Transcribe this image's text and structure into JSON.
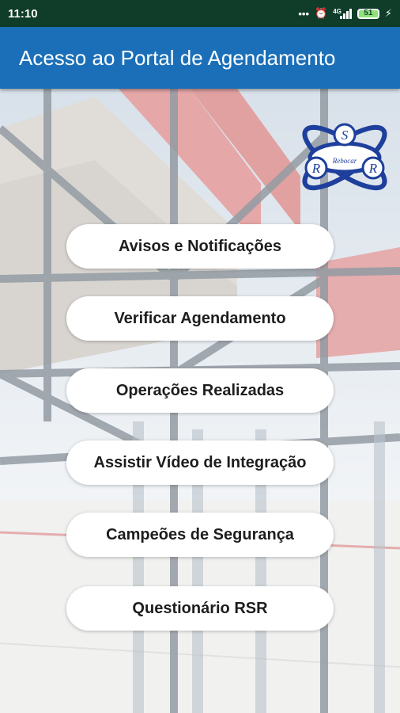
{
  "status_bar": {
    "time": "11:10",
    "network": "4G",
    "battery_level": "51"
  },
  "app_bar": {
    "title": "Acesso ao Portal de Agendamento"
  },
  "logo": {
    "letters": [
      "R",
      "S",
      "R"
    ],
    "subtext": "Rebocar"
  },
  "menu": {
    "items": [
      {
        "label": "Avisos e Notificações"
      },
      {
        "label": "Verificar Agendamento"
      },
      {
        "label": "Operações Realizadas"
      },
      {
        "label": "Assistir Vídeo de Integração"
      },
      {
        "label": "Campeões de Segurança"
      },
      {
        "label": "Questionário RSR"
      }
    ]
  },
  "colors": {
    "app_bar": "#1a6fb8",
    "status_bar": "#0f3d2a",
    "button_bg": "#ffffff",
    "logo_blue": "#1e3f9c"
  }
}
